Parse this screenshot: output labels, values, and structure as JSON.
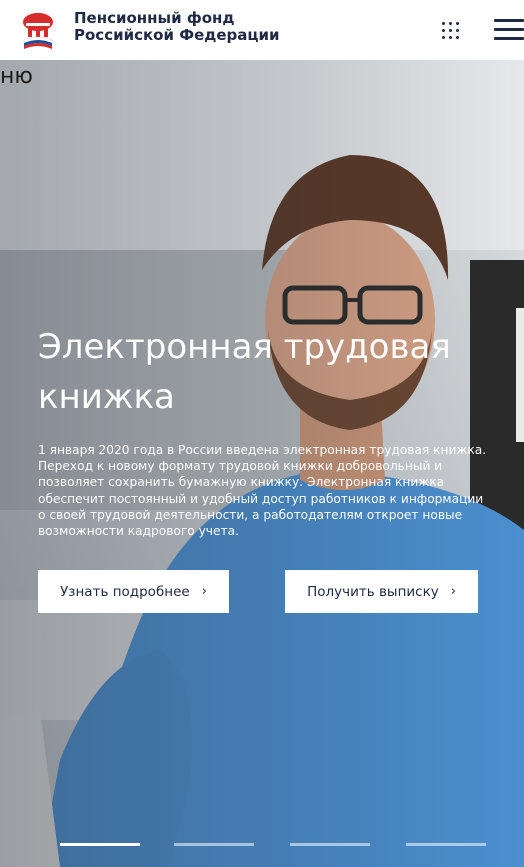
{
  "header": {
    "org_line1": "Пенсионный фонд",
    "org_line2": "Российской Федерации",
    "icons": {
      "apps": "grid-icon",
      "menu": "burger-menu-icon",
      "logo": "pfr-logo"
    }
  },
  "stray_text": "ню",
  "hero": {
    "title_line1": "Электронная трудовая",
    "title_line2": "книжка",
    "description": "1 января 2020 года в России введена электронная трудовая книжка. Переход к новому формату трудовой книжки добровольный и позволяет сохранить бумажную книжку. Электронная книжка обеспечит постоянный и удобный доступ работников к информации о своей трудовой деятельности, а работодателям откроет новые возможности кадрового учета.",
    "buttons": {
      "learn_more": "Узнать подробнее",
      "get_extract": "Получить выписку",
      "chevron": "›"
    },
    "slider": {
      "slides": 4,
      "active": 1
    }
  },
  "colors": {
    "brand": "#1f2a44",
    "logo_red": "#d62c2c",
    "logo_blue": "#1c4f9c",
    "shirt": "#4b8fd0"
  }
}
